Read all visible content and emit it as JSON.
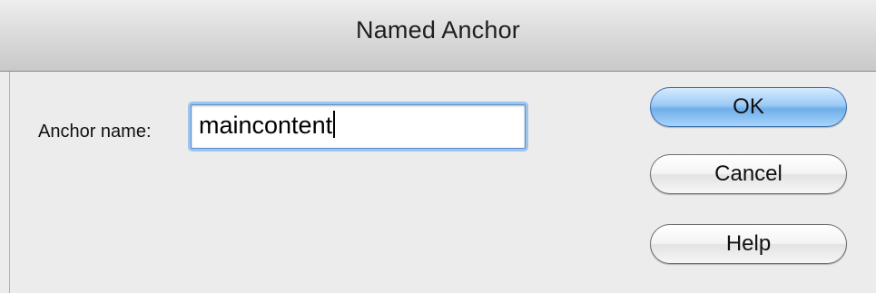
{
  "dialog": {
    "title": "Named Anchor"
  },
  "form": {
    "anchor_label": "Anchor name:",
    "anchor_value": "maincontent"
  },
  "buttons": {
    "ok": "OK",
    "cancel": "Cancel",
    "help": "Help"
  },
  "colors": {
    "default_button": "#8fc2f2",
    "focus_ring": "#9ec4ec"
  }
}
